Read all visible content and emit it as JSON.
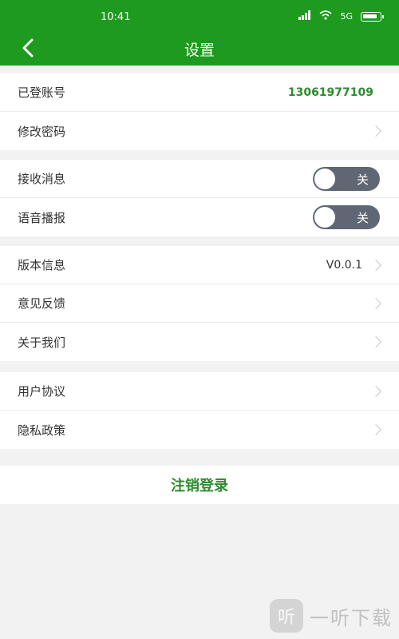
{
  "status_bar": {
    "time": "10:41",
    "signal_text": "5G"
  },
  "header": {
    "title": "设置",
    "back_icon": "chevron-left-icon"
  },
  "account": {
    "logged_in_label": "已登账号",
    "phone": "13061977109",
    "change_password_label": "修改密码"
  },
  "notifications": {
    "receive_label": "接收消息",
    "receive_state": "关",
    "voice_label": "语音播报",
    "voice_state": "关"
  },
  "about": {
    "version_label": "版本信息",
    "version_value": "V0.0.1",
    "feedback_label": "意见反馈",
    "about_us_label": "关于我们"
  },
  "legal": {
    "user_agreement_label": "用户协议",
    "privacy_label": "隐私政策"
  },
  "logout": {
    "label": "注销登录"
  },
  "watermark": {
    "logo_char": "听",
    "text": "一听下载"
  },
  "colors": {
    "brand_green": "#1e9a1e",
    "accent_green": "#2e8b2e",
    "toggle_off": "#5f6775"
  }
}
